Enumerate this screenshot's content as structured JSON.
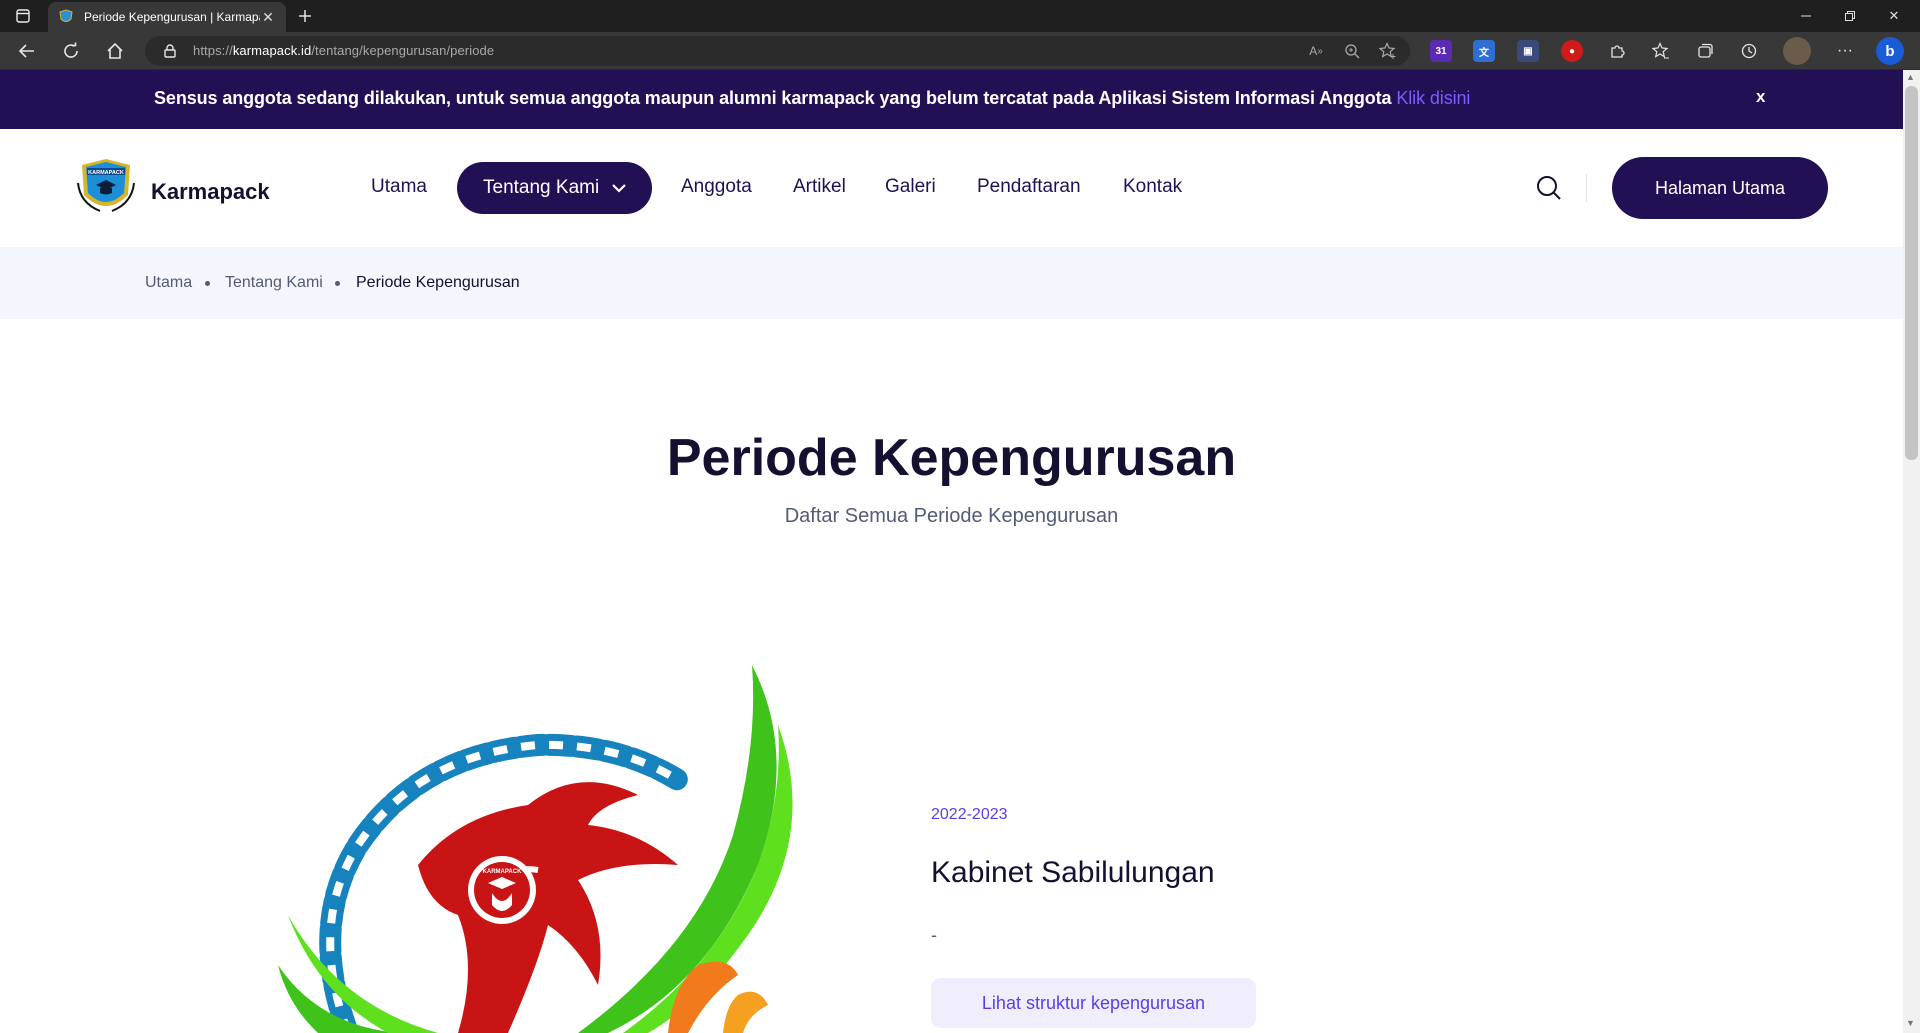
{
  "browser": {
    "tab_title": "Periode Kepengurusan | Karmapack",
    "url_prefix": "https://",
    "url_domain": "karmapack.id",
    "url_path": "/tentang/kepengurusan/periode",
    "extension_badge": "31"
  },
  "banner": {
    "text": "Sensus anggota sedang dilakukan, untuk semua anggota maupun alumni karmapack yang belum tercatat pada Aplikasi Sistem Informasi Anggota ",
    "link": "Klik disini",
    "close": "x"
  },
  "header": {
    "brand": "Karmapack",
    "logo_text": "KARMAPACK",
    "nav": [
      "Utama",
      "Tentang Kami",
      "Anggota",
      "Artikel",
      "Galeri",
      "Pendaftaran",
      "Kontak"
    ],
    "cta": "Halaman Utama"
  },
  "breadcrumb": [
    "Utama",
    "Tentang Kami",
    "Periode Kepengurusan"
  ],
  "page": {
    "title": "Periode Kepengurusan",
    "subtitle": "Daftar Semua Periode Kepengurusan"
  },
  "period_card": {
    "years": "2022-2023",
    "name": "Kabinet Sabilulungan",
    "description": "-",
    "button": "Lihat struktur kepengurusan",
    "logo_text": "KARMAPACK"
  },
  "colors": {
    "primary": "#221054",
    "accent": "#5a3ee6",
    "banner_link": "#7a5cff",
    "breadcrumb_bg": "#f3f6fc"
  }
}
